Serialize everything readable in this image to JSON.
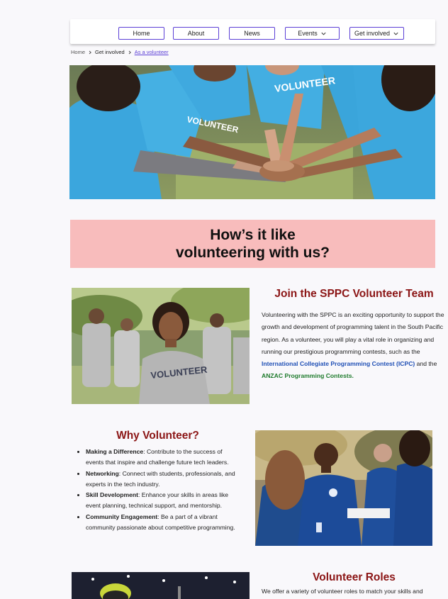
{
  "nav": {
    "items": [
      {
        "label": "Home"
      },
      {
        "label": "About"
      },
      {
        "label": "News"
      },
      {
        "label": "Events"
      },
      {
        "label": "Get involved"
      }
    ]
  },
  "breadcrumb": {
    "home": "Home",
    "parent": "Get involved",
    "current": "As a volunteer"
  },
  "banner": {
    "title": "How’s it like\nvolunteering with us?"
  },
  "join": {
    "title": "Join the SPPC Volunteer Team",
    "text_before": "Volunteering with the SPPC is an exciting opportunity to support the growth and development of programming talent in the South Pacific region. As a volunteer, you will play a vital role in organizing and running our prestigious programming contests, such as the ",
    "icpc_link": "International Collegiate Programming Contest (ICPC)",
    "text_middle": " and the ",
    "anzac_link": "ANZAC Programming Contests.",
    "shirt_text": "VOLUNTEER"
  },
  "why": {
    "title": "Why Volunteer?",
    "items": [
      {
        "bold": "Making a Difference",
        "rest": ": Contribute to the success of events that inspire and challenge future tech leaders."
      },
      {
        "bold": "Networking",
        "rest": ": Connect with students, professionals, and experts in the tech industry."
      },
      {
        "bold": "Skill Development",
        "rest": ": Enhance your skills in areas like event planning, technical support, and mentorship."
      },
      {
        "bold": "Community Engagement",
        "rest": ": Be a part of a vibrant community passionate about competitive programming."
      }
    ]
  },
  "roles": {
    "title": "Volunteer Roles",
    "text": "We offer a variety of volunteer roles to match your skills and"
  },
  "hero": {
    "shirt_text": "VOLUNTEER"
  },
  "colors": {
    "accent": "#5b3fd6",
    "banner_bg": "#f8bcbc",
    "heading_red": "#8b1515",
    "link_blue": "#1f4fb5",
    "link_green": "#1d7a2b"
  }
}
